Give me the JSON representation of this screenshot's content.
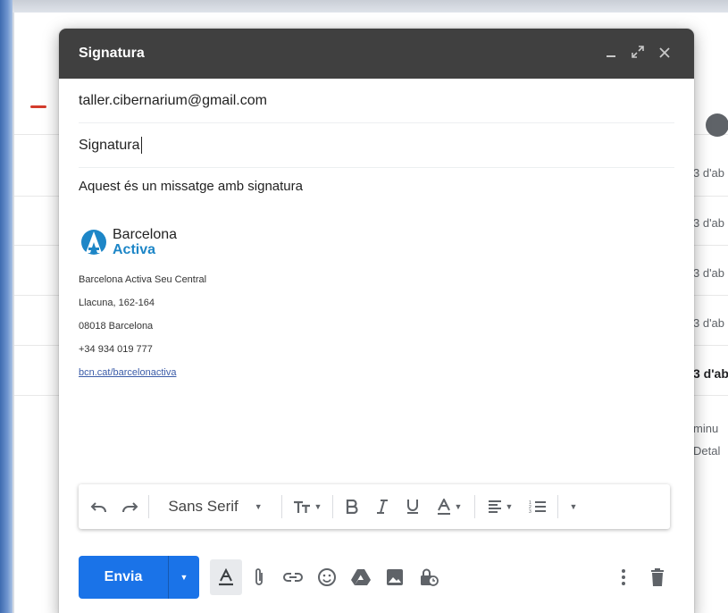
{
  "compose": {
    "title": "Signatura",
    "to": "taller.cibernarium@gmail.com",
    "subject": "Signatura",
    "body": "Aquest és un missatge amb signatura"
  },
  "signature": {
    "logo_line1": "Barcelona",
    "logo_line2": "Activa",
    "lines": [
      "Barcelona Activa Seu Central",
      "Llacuna, 162-164",
      "08018 Barcelona",
      "+34 934 019 777"
    ],
    "link": "bcn.cat/barcelonactiva",
    "brand_color": "#1d86c7"
  },
  "toolbar": {
    "font": "Sans Serif",
    "icons": [
      "undo-icon",
      "redo-icon",
      "text-size-icon",
      "bold-icon",
      "italic-icon",
      "underline-icon",
      "text-color-icon",
      "align-icon",
      "numbered-list-icon",
      "more-formatting-icon"
    ]
  },
  "send": {
    "label": "Envia",
    "color": "#1a73e8"
  },
  "background": {
    "dates": [
      "3 d'ab",
      "3 d'ab",
      "3 d'ab",
      "3 d'ab",
      "3 d'ab"
    ],
    "text1": "minu",
    "text2": "Detal"
  }
}
